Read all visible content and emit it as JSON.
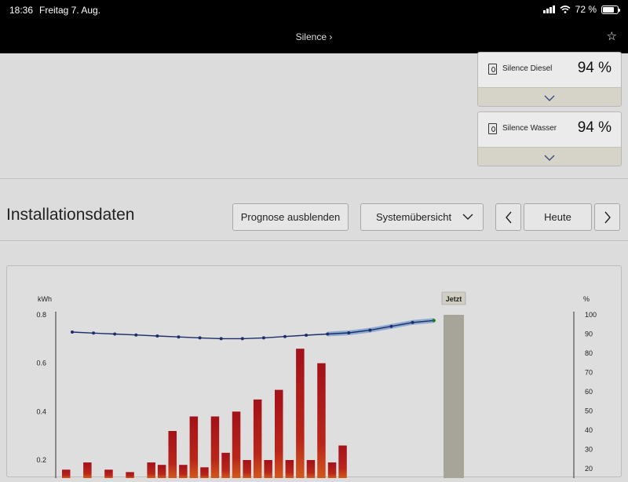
{
  "status_bar": {
    "time": "18:36",
    "date": "Freitag 7. Aug.",
    "battery": "72 %",
    "battery_level": 0.72
  },
  "nav": {
    "title": "Silence",
    "title_chevron": "chevron-right-icon",
    "star": "star-icon"
  },
  "tanks": [
    {
      "name": "Silence Diesel",
      "value": "94 %"
    },
    {
      "name": "Silence Wasser",
      "value": "94 %"
    }
  ],
  "section": {
    "title": "Installationsdaten",
    "prognose_button": "Prognose ausblenden",
    "view_select": "Systemübersicht",
    "today_button": "Heute"
  },
  "chart_data": {
    "type": "bar",
    "left_axis": {
      "unit": "kWh",
      "ticks": [
        "0.8",
        "0.6",
        "0.4",
        "0.2"
      ],
      "ylim": [
        0,
        0.8
      ]
    },
    "right_axis": {
      "unit": "%",
      "ticks": [
        "100",
        "90",
        "80",
        "70",
        "60",
        "50",
        "40",
        "30",
        "20"
      ],
      "ylim": [
        20,
        100
      ]
    },
    "now_label": "Jetzt",
    "series": [
      {
        "kind": "bar",
        "values": [
          0.16,
          0,
          0.19,
          0,
          0.16,
          0,
          0.15,
          0,
          0.19,
          0.18,
          0.32,
          0.18,
          0.38,
          0.17,
          0.38,
          0.23,
          0.4,
          0.2,
          0.45,
          0.2,
          0.49,
          0.2,
          0.66,
          0.2,
          0.6,
          0.19,
          0.26
        ]
      },
      {
        "kind": "line",
        "axis": "right",
        "values": [
          91,
          90.5,
          90,
          89.5,
          89,
          88.5,
          88,
          87.6,
          87.6,
          88,
          88.7,
          89.4,
          90,
          90.6,
          92,
          94,
          96,
          97
        ]
      }
    ],
    "grid": false
  }
}
